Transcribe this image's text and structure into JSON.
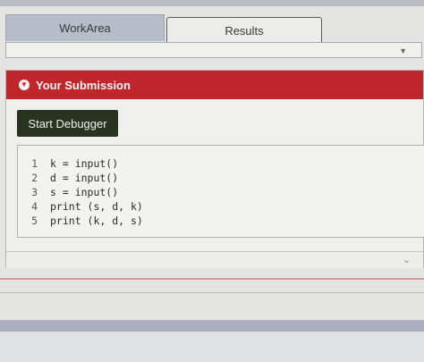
{
  "tabs": {
    "workarea_label": "WorkArea",
    "results_label": "Results"
  },
  "dropdown": {
    "icon": "chevron-down-icon"
  },
  "panel": {
    "title": "Your Submission",
    "header_icon": "chevron-circle-down-icon",
    "header_color": "#c0272d",
    "debugger_button": "Start Debugger",
    "code_lines": [
      {
        "num": "1",
        "code": "k = input()"
      },
      {
        "num": "2",
        "code": "d = input()"
      },
      {
        "num": "3",
        "code": "s = input()"
      },
      {
        "num": "4",
        "code": "print (s, d, k)"
      },
      {
        "num": "5",
        "code": "print (k, d, s)"
      }
    ],
    "collapse_icon": "double-chevron-down-icon"
  }
}
